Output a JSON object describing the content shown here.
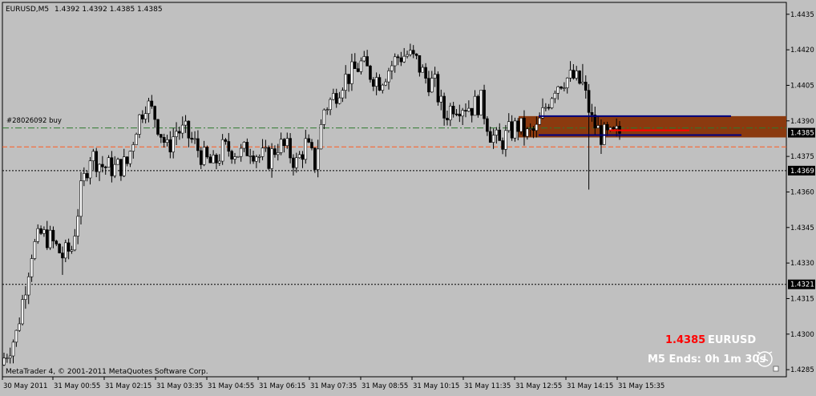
{
  "header": {
    "symbol_timeframe": "EURUSD,M5",
    "ohlc": "1.4392 1.4392 1.4385 1.4385"
  },
  "copyright": "MetaTrader 4, © 2001-2011 MetaQuotes Software Corp.",
  "info_panel": {
    "price": "1.4385",
    "symbol": "EURUSD",
    "bar_timer": "M5 Ends: 0h 1m 30s"
  },
  "order_label": "#28026092 buy",
  "colors": {
    "background": "#c0c0c0",
    "candle_up": "#ffffff",
    "candle_down": "#000000",
    "zone_fill": "#8b3a0f",
    "zone_line": "#000080",
    "order_line": "#2f7a2f",
    "stop_line": "#ff5a1f",
    "price_red": "#ff0000"
  },
  "chart_data": {
    "type": "candlestick",
    "ylim": [
      1.4282,
      1.444
    ],
    "y_ticks": [
      "1.4435",
      "1.4420",
      "1.4405",
      "1.4390",
      "1.4375",
      "1.4360",
      "1.4345",
      "1.4330",
      "1.4315",
      "1.4300",
      "1.4285"
    ],
    "x_tick_labels": [
      "30 May 2011",
      "31 May 00:55",
      "31 May 02:15",
      "31 May 03:35",
      "31 May 04:55",
      "31 May 06:15",
      "31 May 07:35",
      "31 May 08:55",
      "31 May 10:15",
      "31 May 11:35",
      "31 May 12:55",
      "31 May 14:15",
      "31 May 15:35"
    ],
    "highlighted_prices": [
      {
        "label": "1.4385",
        "value": 1.4385,
        "role": "current bid"
      },
      {
        "label": "1.4369",
        "value": 1.4369,
        "role": "horizontal line"
      },
      {
        "label": "1.4321",
        "value": 1.4321,
        "role": "horizontal line"
      }
    ],
    "order_line": {
      "value": 1.4387
    },
    "stop_line": {
      "value": 1.4379
    },
    "zone": {
      "top": 1.4392,
      "bottom": 1.4383,
      "upper_line": 1.4392,
      "lower_line": 1.4384,
      "inner_red_line": 1.4386
    },
    "anchors": [
      [
        0,
        1.429
      ],
      [
        4,
        1.43
      ],
      [
        9,
        1.4335
      ],
      [
        12,
        1.4342
      ],
      [
        15,
        1.434
      ],
      [
        19,
        1.4333
      ],
      [
        22,
        1.4336
      ],
      [
        25,
        1.436
      ],
      [
        28,
        1.4376
      ],
      [
        32,
        1.4371
      ],
      [
        36,
        1.437
      ],
      [
        40,
        1.4372
      ],
      [
        43,
        1.4388
      ],
      [
        46,
        1.4398
      ],
      [
        49,
        1.4392
      ],
      [
        53,
        1.4378
      ],
      [
        56,
        1.4386
      ],
      [
        59,
        1.4385
      ],
      [
        62,
        1.438
      ],
      [
        65,
        1.4374
      ],
      [
        68,
        1.4371
      ],
      [
        71,
        1.4378
      ],
      [
        74,
        1.4378
      ],
      [
        77,
        1.4376
      ],
      [
        80,
        1.4379
      ],
      [
        83,
        1.4375
      ],
      [
        86,
        1.4374
      ],
      [
        89,
        1.438
      ],
      [
        92,
        1.4378
      ],
      [
        95,
        1.4372
      ],
      [
        98,
        1.438
      ],
      [
        101,
        1.4372
      ],
      [
        104,
        1.4395
      ],
      [
        107,
        1.44
      ],
      [
        110,
        1.4407
      ],
      [
        113,
        1.441
      ],
      [
        116,
        1.4414
      ],
      [
        119,
        1.441
      ],
      [
        122,
        1.4407
      ],
      [
        125,
        1.4412
      ],
      [
        128,
        1.4417
      ],
      [
        131,
        1.4418
      ],
      [
        134,
        1.4415
      ],
      [
        137,
        1.4408
      ],
      [
        140,
        1.4405
      ],
      [
        143,
        1.4392
      ],
      [
        146,
        1.4397
      ],
      [
        149,
        1.4397
      ],
      [
        152,
        1.4396
      ],
      [
        155,
        1.4398
      ],
      [
        158,
        1.4385
      ],
      [
        161,
        1.438
      ],
      [
        164,
        1.4385
      ],
      [
        167,
        1.4388
      ],
      [
        170,
        1.4384
      ],
      [
        173,
        1.4386
      ],
      [
        176,
        1.4396
      ],
      [
        179,
        1.4405
      ],
      [
        182,
        1.4408
      ],
      [
        185,
        1.4408
      ],
      [
        188,
        1.4405
      ],
      [
        191,
        1.439
      ],
      [
        194,
        1.4384
      ],
      [
        197,
        1.4383
      ],
      [
        200,
        1.4385
      ]
    ],
    "notable_wicks": [
      {
        "bar": 19,
        "low": 1.4325
      },
      {
        "bar": 190,
        "low": 1.4361
      },
      {
        "bar": 188,
        "high": 1.4414
      },
      {
        "bar": 133,
        "high": 1.4422
      }
    ]
  }
}
